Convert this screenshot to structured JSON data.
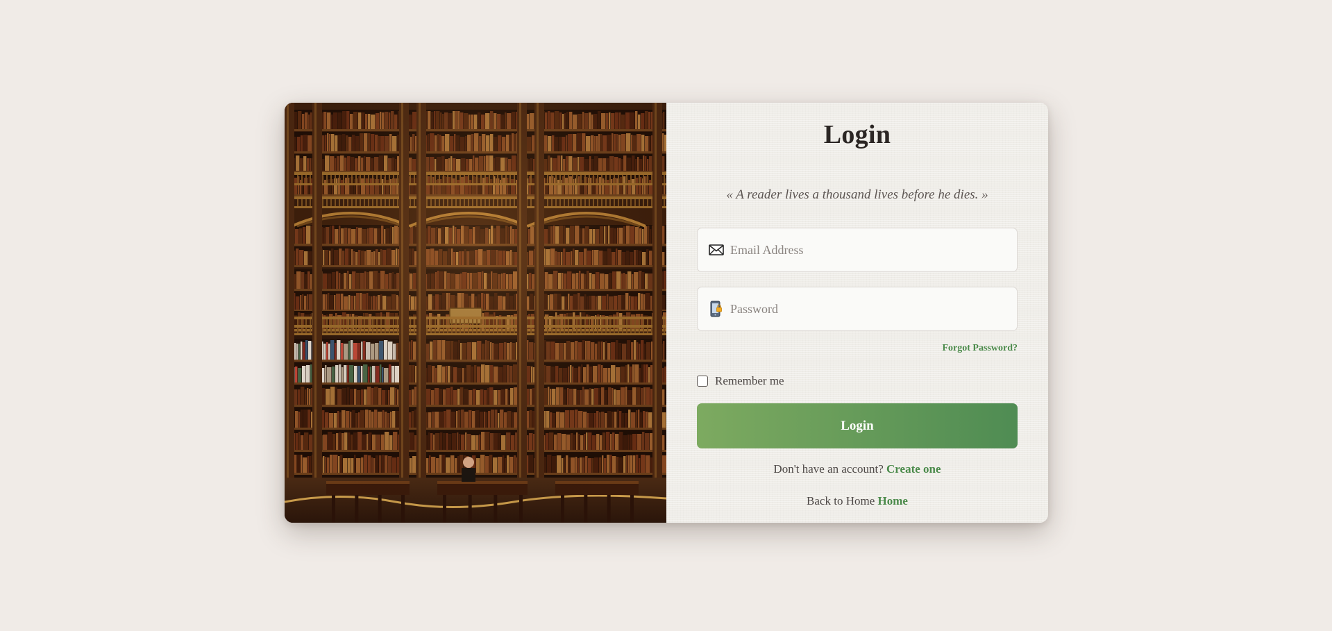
{
  "login_form": {
    "title": "Login",
    "quote": "« A reader lives a thousand lives before he dies. »",
    "email": {
      "placeholder": "Email Address",
      "value": "",
      "icon": "envelope-icon"
    },
    "password": {
      "placeholder": "Password",
      "value": "",
      "icon": "phone-lock-icon"
    },
    "forgot_password": "Forgot Password?",
    "remember_me": {
      "label": "Remember me",
      "checked": false
    },
    "submit_label": "Login",
    "signup_prompt": "Don't have an account?",
    "signup_link": "Create one",
    "home_prompt": "Back to Home",
    "home_link": "Home"
  },
  "hero_image": {
    "subject": "library-bookshelves-photo"
  },
  "colors": {
    "background": "#f0ebe7",
    "accent_green": "#4a8a4a",
    "button_gradient_start": "#7daa60",
    "button_gradient_end": "#4f8c53",
    "title_text": "#2b2624"
  }
}
